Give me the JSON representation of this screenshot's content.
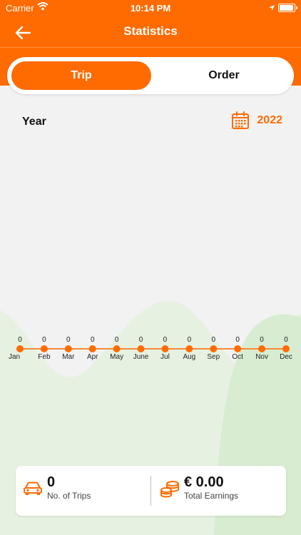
{
  "status_bar": {
    "carrier": "Carrier",
    "time": "10:14 PM"
  },
  "header": {
    "title": "Statistics"
  },
  "tabs": [
    {
      "label": "Trip",
      "selected": true
    },
    {
      "label": "Order",
      "selected": false
    }
  ],
  "filter": {
    "period_label": "Year",
    "year": "2022"
  },
  "chart_data": {
    "type": "line",
    "categories": [
      "Jan",
      "Feb",
      "Mar",
      "Apr",
      "May",
      "June",
      "Jul",
      "Aug",
      "Sep",
      "Oct",
      "Nov",
      "Dec"
    ],
    "values": [
      0,
      0,
      0,
      0,
      0,
      0,
      0,
      0,
      0,
      0,
      0,
      0
    ],
    "data_labels": [
      "0",
      "0",
      "0",
      "0",
      "0",
      "0",
      "0",
      "0",
      "0",
      "0",
      "0",
      "0"
    ],
    "title": "",
    "xlabel": "",
    "ylabel": "",
    "grid": false
  },
  "summary": {
    "trips": {
      "value": "0",
      "label": "No. of Trips"
    },
    "earnings": {
      "value": "€ 0.00",
      "label": "Total Earnings"
    }
  },
  "colors": {
    "accent": "#ff6b00",
    "background": "#f2f2f2",
    "hill": "#d8ecd2"
  },
  "icons": {
    "back": "arrow-left-icon",
    "calendar": "calendar-icon",
    "trips": "car-icon",
    "earnings": "coins-icon"
  }
}
